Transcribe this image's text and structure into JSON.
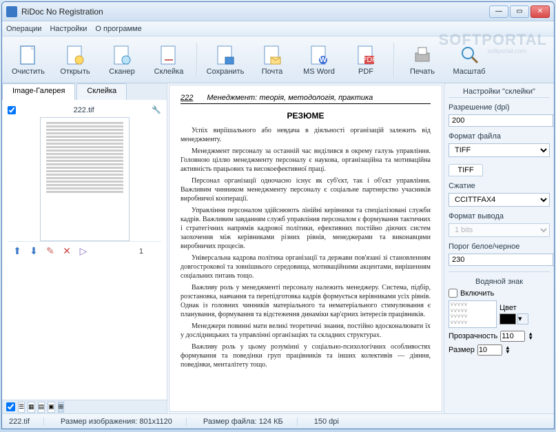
{
  "title": "RiDoc No Registration",
  "menu": {
    "ops": "Операции",
    "settings": "Настройки",
    "about": "О программе"
  },
  "watermark": "SOFTPORTAL",
  "watermark_sub": "softportal.com",
  "toolbar": {
    "clear": "Очистить",
    "open": "Открыть",
    "scanner": "Сканер",
    "stitch": "Склейка",
    "save": "Сохранить",
    "mail": "Почта",
    "word": "MS Word",
    "pdf": "PDF",
    "print": "Печать",
    "scale": "Масштаб"
  },
  "tabs": {
    "gallery": "Image-Галерея",
    "stitch": "Склейка"
  },
  "thumb": {
    "name": "222.tif",
    "page": "1"
  },
  "preview": {
    "pgnum": "222",
    "header": "Менеджмент: теорія, методологія, практика",
    "resume": "РЕЗЮМЕ",
    "p1": "Успіх виріішального або невдача в діяльності організацій залежить від менеджменту.",
    "p2": "Менеджмент персоналу за останній час виділився в окрему галузь управління. Головною ціллю менеджменту персоналу є наукова, організаційна та мотиваційна активність працьових та високоефективної праці.",
    "p3": "Персонал організації одночасно існує як суб'єкт, так і об'єкт управління. Важливим чинником менеджменту персоналу є соціальне партнерство учасників виробничої кооперації.",
    "p4": "Управління персоналом здійснюють лінійні керівники та спеціалізовані служби кадрів. Важливим завданням служб управління персоналом є формування тактичних і стратегічних напрямів кадрової політики, ефективних постійно діючих систем заохочення між керівниками різних рівнів, менеджерами та виконавцями виробничих процесів.",
    "p5": "Універсальна кадрова політика організації та держави пов'язані зі становленням довгострокової та зовнішнього середовища, мотиваційними акцентами, вирішенням соціальних питань тощо.",
    "p6": "Важливу роль у менеджменті персоналу належить менеджеру. Система, підбір, розстановка, навчання та перепідготовка кадрів формується керівниками усіх рівнів. Однак із головних чинників матеріального та нематеріального стимулювання є планування, формування та відстеження динаміки кар'єрних інтересів працівників.",
    "p7": "Менеджери повинні мати великі теоретичні знання, постійно вдосконалювати їх у дослідницьких та управлінні організаціях та складних структурах.",
    "p8": "Важливу роль у цьому розумінні у соціально-психологічних особливостях формування та поведінки груп працівників та інших колективів — діяння, поведінки, менталітету тощо."
  },
  "right": {
    "header": "Настройки \"склейки\"",
    "res_label": "Разрешение (dpi)",
    "res_value": "200",
    "fmt_label": "Формат файла",
    "fmt_value": "TIFF",
    "tab": "TIFF",
    "compress_label": "Сжатие",
    "compress_value": "CCITTFAX4",
    "output_label": "Формат вывода",
    "output_value": "1 bits",
    "thresh_label": "Порог белое/черное",
    "thresh_value": "230",
    "wm_header": "Водяной знак",
    "wm_enable": "Включить",
    "wm_color": "Цвет",
    "wm_opacity_label": "Прозрачность",
    "wm_opacity_value": "110",
    "wm_size_label": "Размер",
    "wm_size_value": "10"
  },
  "status": {
    "file": "222.tif",
    "imgsize_label": "Размер изображения:",
    "imgsize": "801x1120",
    "filesize_label": "Размер файла:",
    "filesize": "124 КБ",
    "dpi": "150 dpi"
  }
}
